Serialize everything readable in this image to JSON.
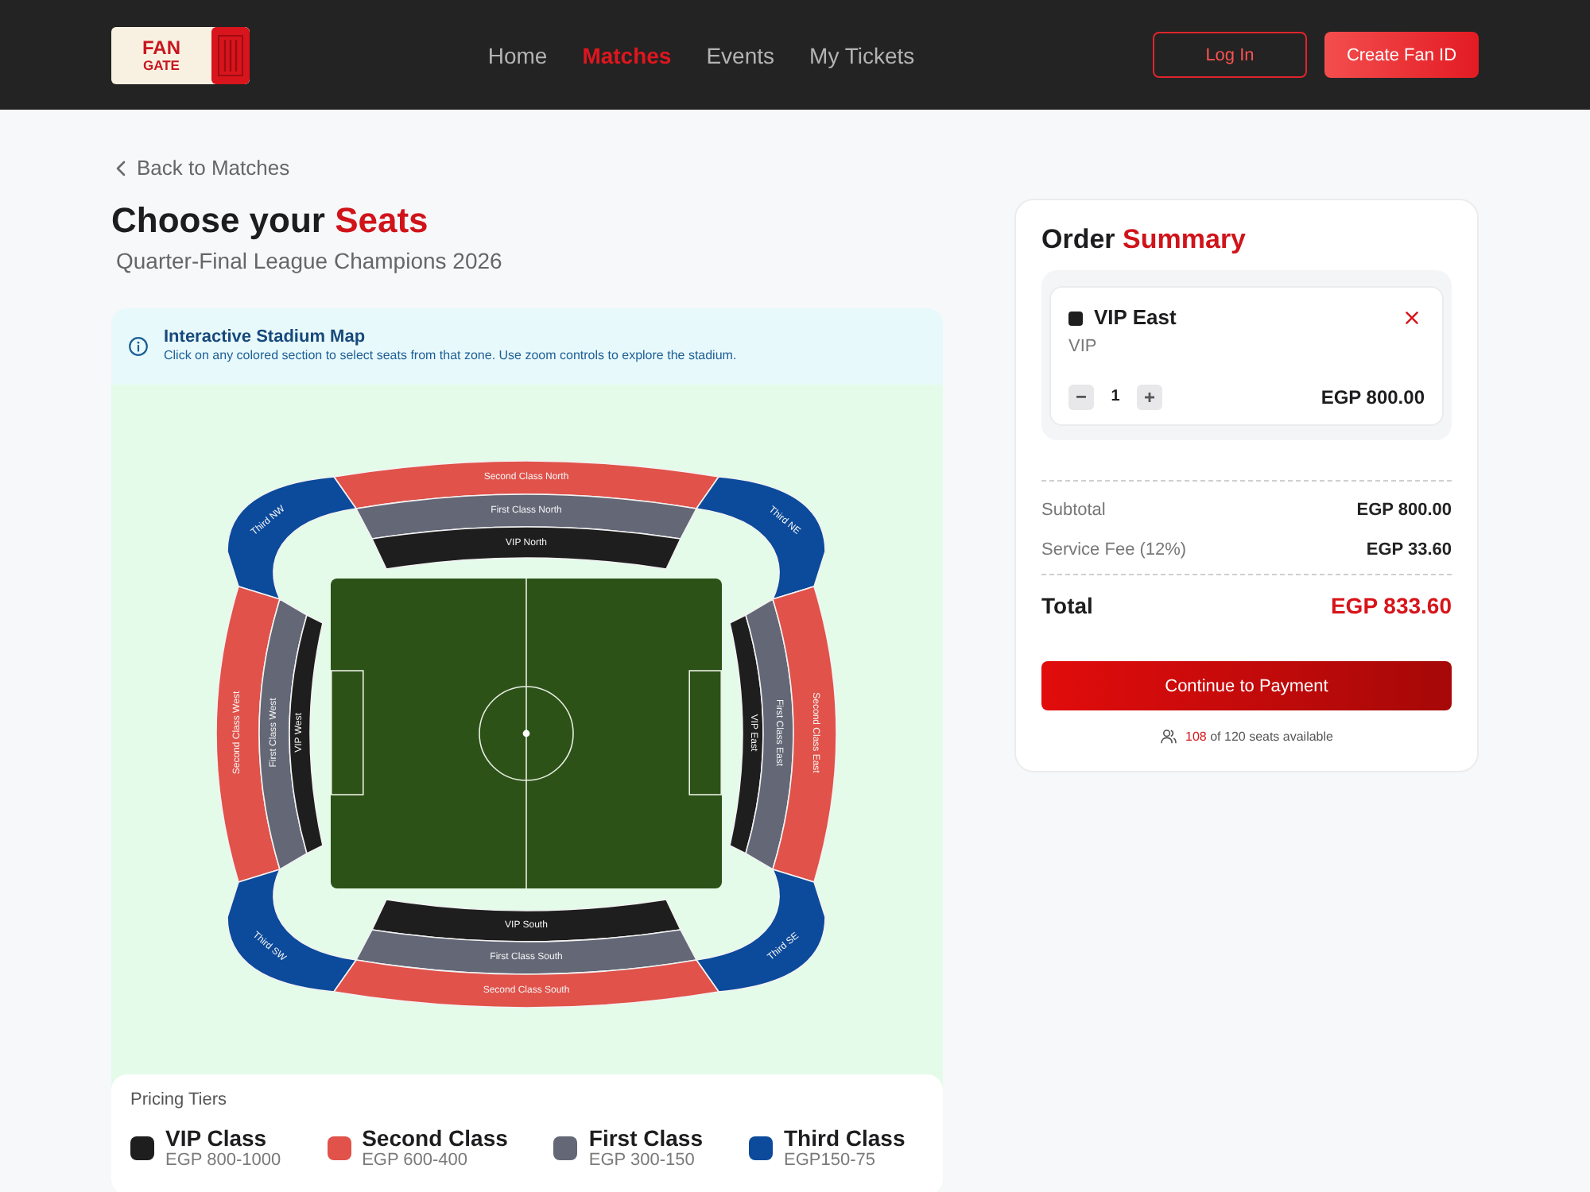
{
  "header": {
    "logo": [
      "FAN",
      "GATE"
    ],
    "nav": [
      {
        "label": "Home",
        "selected": false
      },
      {
        "label": "Matches",
        "selected": true
      },
      {
        "label": "Events",
        "selected": false
      },
      {
        "label": "My Tickets",
        "selected": false
      }
    ],
    "buttons": [
      {
        "label": "Log In",
        "kind": "outline"
      },
      {
        "label": "Create Fan ID",
        "kind": "filled"
      }
    ]
  },
  "back_link": "Back to Matches",
  "title": {
    "text": "Choose your",
    "highlight": "Seats"
  },
  "subtitle": "Quarter-Final League Champions 2026",
  "info": {
    "title": "Interactive Stadium Map",
    "text": "Click on any colored section to select seats from that zone. Use zoom controls to explore the stadium."
  },
  "stadium": {
    "sections": [
      {
        "label": "Second Class North",
        "color": "#e0524a"
      },
      {
        "label": "First Class North",
        "color": "#636776"
      },
      {
        "label": "VIP North",
        "color": "#1e1e1e"
      },
      {
        "label": "Third NW",
        "color": "#0c4a9b"
      },
      {
        "label": "Third NE",
        "color": "#0c4a9b"
      },
      {
        "label": "Second Class West",
        "color": "#e0524a"
      },
      {
        "label": "First Class West",
        "color": "#636776"
      },
      {
        "label": "VIP West",
        "color": "#1e1e1e"
      },
      {
        "label": "VIP East",
        "color": "#1e1e1e"
      },
      {
        "label": "First Class East",
        "color": "#636776"
      },
      {
        "label": "Second Class East",
        "color": "#e0524a"
      },
      {
        "label": "Third SW",
        "color": "#0c4a9b"
      },
      {
        "label": "Third SE",
        "color": "#0c4a9b"
      },
      {
        "label": "VIP South",
        "color": "#1e1e1e"
      },
      {
        "label": "First Class South",
        "color": "#636776"
      },
      {
        "label": "Second Class South",
        "color": "#e0524a"
      }
    ]
  },
  "pricing": {
    "label": "Pricing Tiers",
    "tiers": [
      {
        "name": "VIP Class",
        "price": "EGP 800-1000",
        "color": "#1e1e1e"
      },
      {
        "name": "Second Class",
        "price": "EGP 600-400",
        "color": "#e0524a"
      },
      {
        "name": "First Class",
        "price": "EGP 300-150",
        "color": "#636776"
      },
      {
        "name": "Third Class",
        "price": "EGP150-75",
        "color": "#0c4a9b"
      }
    ]
  },
  "order_summary": {
    "title": {
      "text": "Order",
      "highlight": "Summary"
    },
    "items": [
      {
        "name": "VIP East",
        "tier": "VIP",
        "color": "#1e1e1e",
        "quantity": "1",
        "price": "EGP 800.00"
      }
    ],
    "rows": [
      {
        "label": "Subtotal",
        "value": "EGP 800.00"
      },
      {
        "label": "Service Fee (12%)",
        "value": "EGP 33.60"
      }
    ],
    "total": {
      "label": "Total",
      "value": "EGP 833.60"
    },
    "button": "Continue to Payment",
    "availability": {
      "count": "108",
      "text": "of 120 seats available"
    }
  }
}
